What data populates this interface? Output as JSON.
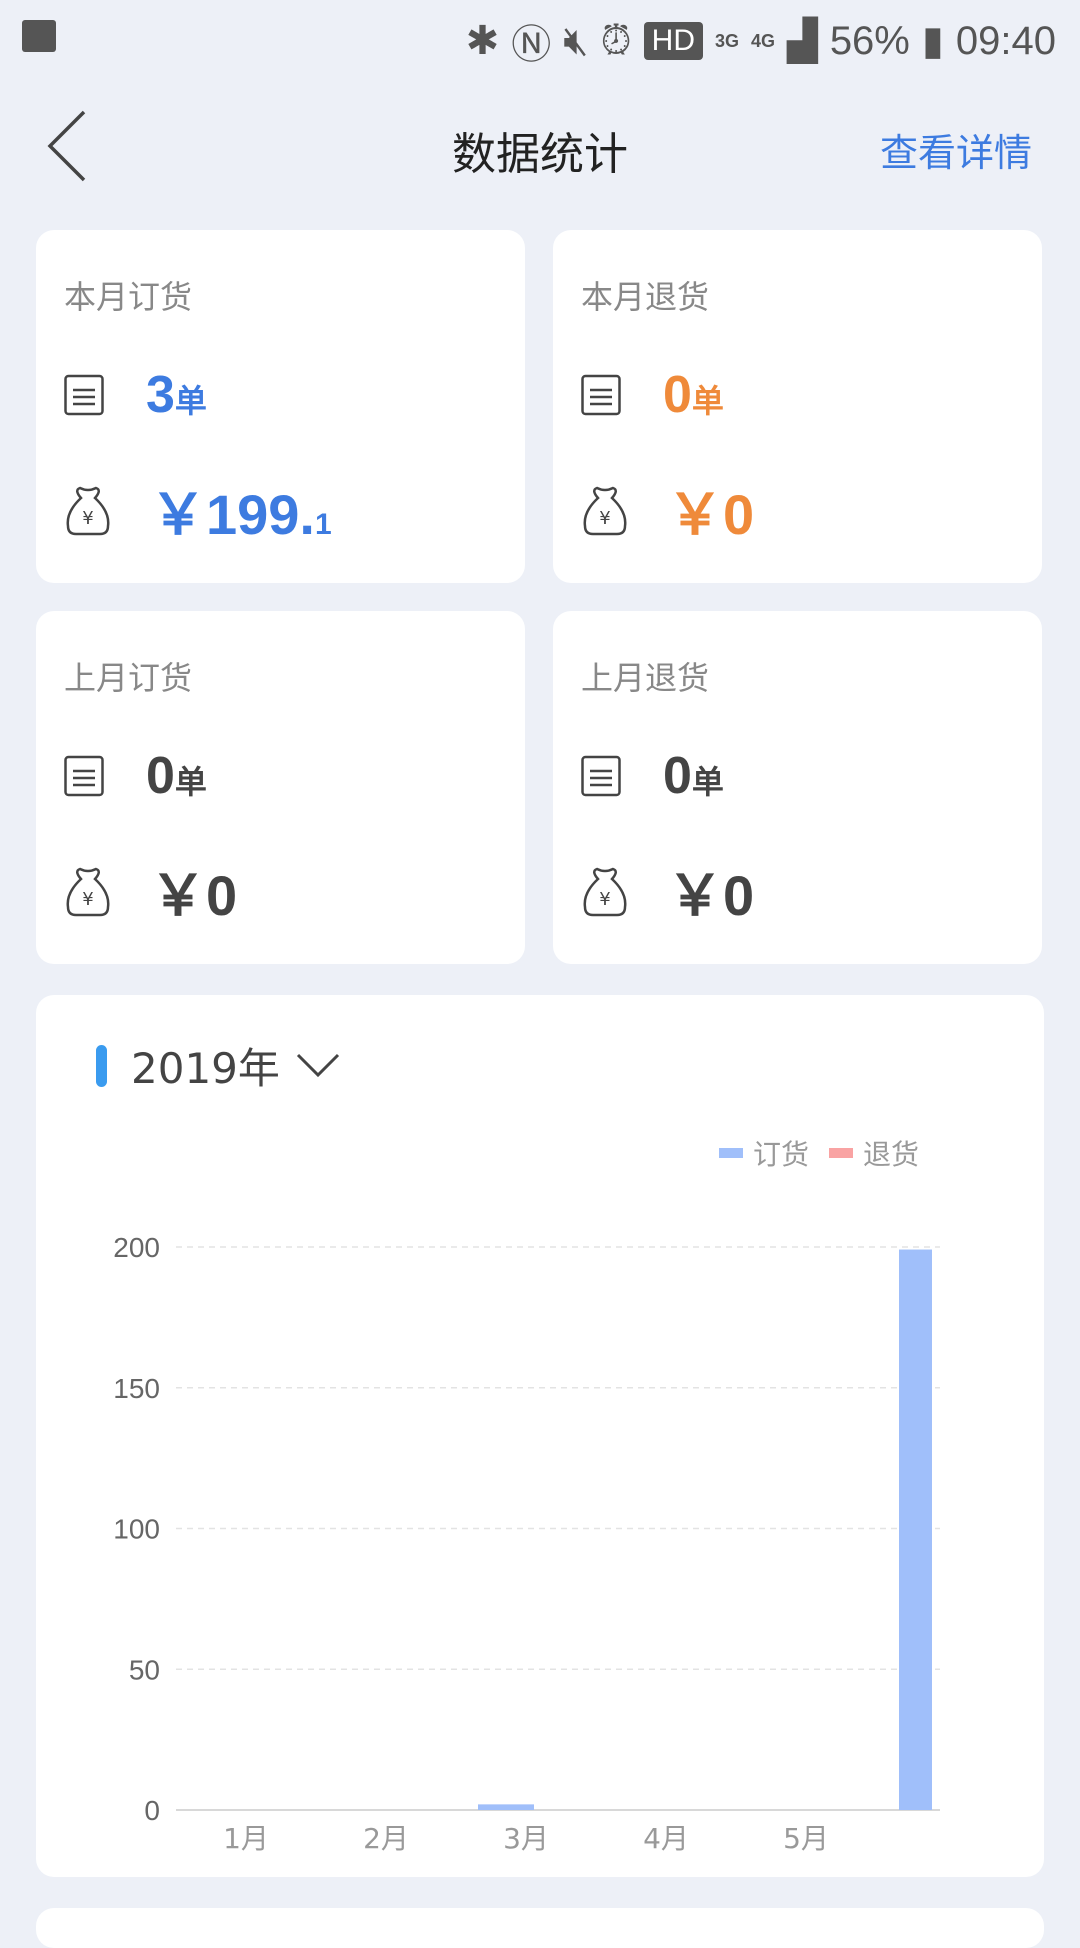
{
  "status_bar": {
    "icons": [
      "image-icon",
      "bluetooth-icon",
      "nfc-icon",
      "mute-icon",
      "alarm-icon"
    ],
    "hd": "HD",
    "net1": "3G",
    "net2": "4G",
    "battery": "56%",
    "time": "09:40"
  },
  "header": {
    "title": "数据统计",
    "detail_link": "查看详情",
    "back_icon": "chevron-left-icon"
  },
  "cards": [
    {
      "label": "本月订货",
      "count": "3",
      "unit": "单",
      "amount_main": "￥199.",
      "amount_cents": "1",
      "color": "#3d7be0"
    },
    {
      "label": "本月退货",
      "count": "0",
      "unit": "单",
      "amount_main": "￥0",
      "amount_cents": "",
      "color": "#ef8a3a"
    },
    {
      "label": "上月订货",
      "count": "0",
      "unit": "单",
      "amount_main": "￥0",
      "amount_cents": "",
      "color": "#444444"
    },
    {
      "label": "上月退货",
      "count": "0",
      "unit": "单",
      "amount_main": "￥0",
      "amount_cents": "",
      "color": "#444444"
    }
  ],
  "chart": {
    "year": "2019年"
  },
  "chart_data": {
    "type": "bar",
    "categories": [
      "1月",
      "2月",
      "3月",
      "4月",
      "5月",
      ""
    ],
    "series": [
      {
        "name": "订货",
        "color": "#a0bffa",
        "values": [
          0,
          0,
          2,
          0,
          0,
          199.1
        ]
      },
      {
        "name": "退货",
        "color": "#f9a3a3",
        "values": [
          0,
          0,
          0,
          0,
          0,
          0
        ]
      }
    ],
    "yticks": [
      "0",
      "50",
      "100",
      "150",
      "200"
    ],
    "ylim": [
      0,
      200
    ],
    "grid": true,
    "legend": "top-right"
  }
}
